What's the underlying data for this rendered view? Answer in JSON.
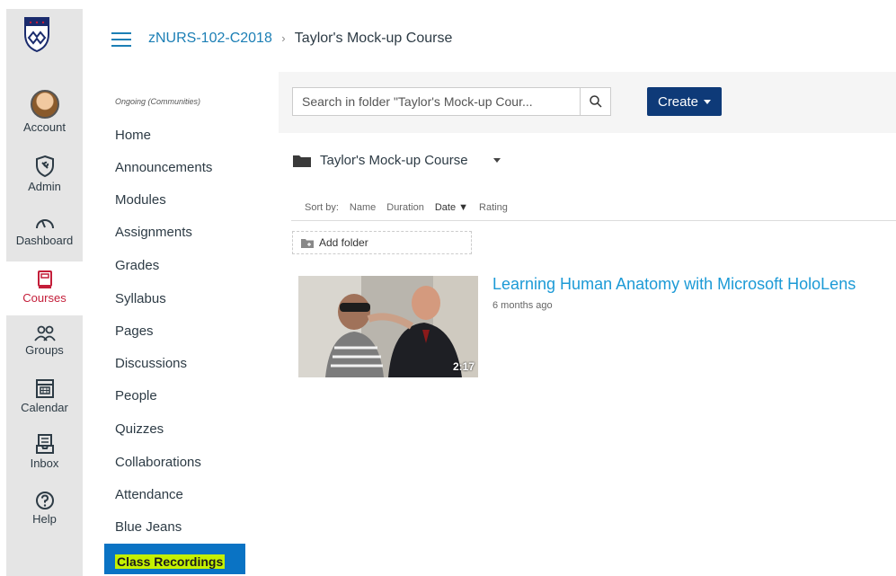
{
  "global_nav": {
    "items": [
      {
        "label": "Account",
        "icon": "avatar"
      },
      {
        "label": "Admin",
        "icon": "shield-wrench-icon"
      },
      {
        "label": "Dashboard",
        "icon": "speedometer-icon"
      },
      {
        "label": "Courses",
        "icon": "book-icon"
      },
      {
        "label": "Groups",
        "icon": "people-icon"
      },
      {
        "label": "Calendar",
        "icon": "calendar-icon"
      },
      {
        "label": "Inbox",
        "icon": "inbox-icon"
      },
      {
        "label": "Help",
        "icon": "question-icon"
      }
    ],
    "active_color": "#c41e3a"
  },
  "header": {
    "course_link": "zNURS-102-C2018",
    "separator": "›",
    "current": "Taylor's Mock-up Course"
  },
  "course_nav": {
    "term": "Ongoing (Communities)",
    "links": [
      "Home",
      "Announcements",
      "Modules",
      "Assignments",
      "Grades",
      "Syllabus",
      "Pages",
      "Discussions",
      "People",
      "Quizzes",
      "Collaborations",
      "Attendance",
      "Blue Jeans",
      "Class Recordings"
    ]
  },
  "panopto": {
    "search_placeholder": "Search in folder \"Taylor's Mock-up Cour...",
    "create_label": "Create",
    "folder_name": "Taylor's Mock-up Course",
    "sort_label": "Sort by:",
    "sort_options": [
      "Name",
      "Duration",
      "Date ▼",
      "Rating"
    ],
    "add_folder_label": "Add folder",
    "video": {
      "title": "Learning Human Anatomy with Microsoft HoloLens",
      "age": "6 months ago",
      "duration": "2:17"
    },
    "accent_color": "#0e3a78",
    "link_color": "#1c9ad6"
  }
}
